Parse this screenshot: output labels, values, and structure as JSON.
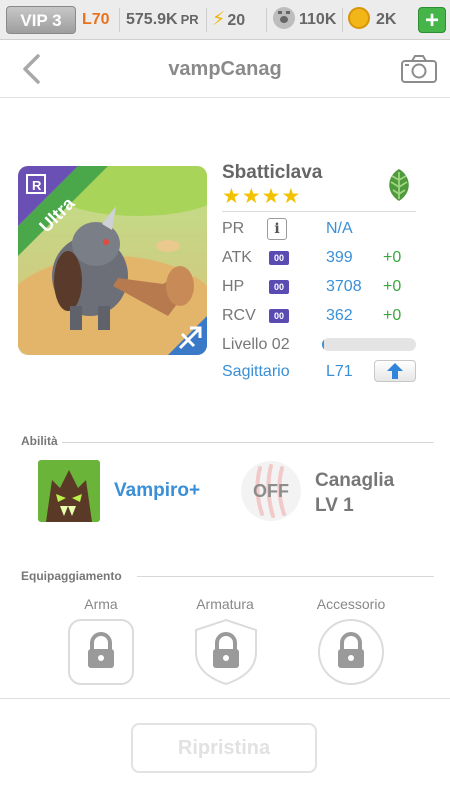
{
  "topbar": {
    "vip": "VIP 3",
    "level": "L70",
    "pr_value": "575.9K",
    "pr_unit": "PR",
    "energy": "20",
    "paws": "110K",
    "coins": "2K",
    "plus": "+"
  },
  "header": {
    "title": "vampCanag"
  },
  "pet": {
    "rarity": "Ultra",
    "name": "Sbatticlava",
    "stars": "★★★★",
    "stats": {
      "pr": {
        "label": "PR",
        "info_icon": "i",
        "value": "N/A"
      },
      "atk": {
        "label": "ATK",
        "badge": "00",
        "value": "399",
        "bonus": "+0"
      },
      "hp": {
        "label": "HP",
        "badge": "00",
        "value": "3708",
        "bonus": "+0"
      },
      "rcv": {
        "label": "RCV",
        "badge": "00",
        "value": "362",
        "bonus": "+0"
      }
    },
    "level_label": "Livello 02",
    "level_progress": 0.02,
    "zodiac": "Sagittario",
    "zodiac_level": "L71"
  },
  "abilities": {
    "section_label": "Abilità",
    "active_skill": "Vampiro+",
    "passive_state": "OFF",
    "leader_skill_name": "Canaglia",
    "leader_skill_level": "LV 1"
  },
  "equipment": {
    "section_label": "Equipaggiamento",
    "slots": [
      "Arma",
      "Armatura",
      "Accessorio"
    ]
  },
  "footer": {
    "reset_label": "Ripristina"
  },
  "colors": {
    "accent": "#3a8fd6",
    "bonus": "#3aa83f",
    "rarity_banner": "#4aa84a",
    "level_color": "#e8731f"
  },
  "icons": [
    "back-icon",
    "camera-icon",
    "leaf-element-icon",
    "info-icon",
    "upgrade-arrow-icon",
    "lock-icon",
    "sagittarius-icon",
    "paw-icon",
    "coin-icon",
    "energy-icon"
  ]
}
